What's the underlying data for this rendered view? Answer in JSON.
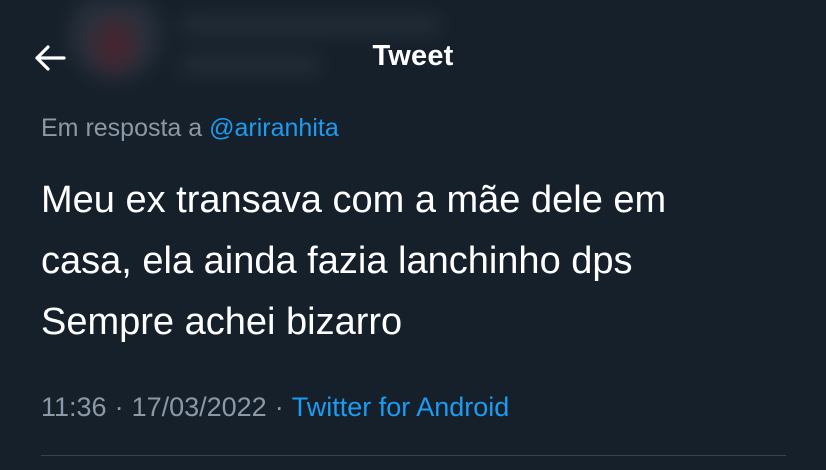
{
  "header": {
    "title": "Tweet",
    "back_icon": "arrow-left-icon"
  },
  "tweet": {
    "reply_prefix": "Em resposta a",
    "reply_mention": "@ariranhita",
    "text_lines": [
      "Meu ex transava com a mãe dele em",
      "casa, ela ainda fazia lanchinho dps",
      "Sempre achei bizarro"
    ],
    "time": "11:36",
    "date": "17/03/2022",
    "separator": "·",
    "source": "Twitter for Android"
  },
  "colors": {
    "background": "#15202b",
    "accent": "#1d9bf0",
    "secondary_text": "#8b98a5",
    "primary_text": "#ffffff"
  }
}
